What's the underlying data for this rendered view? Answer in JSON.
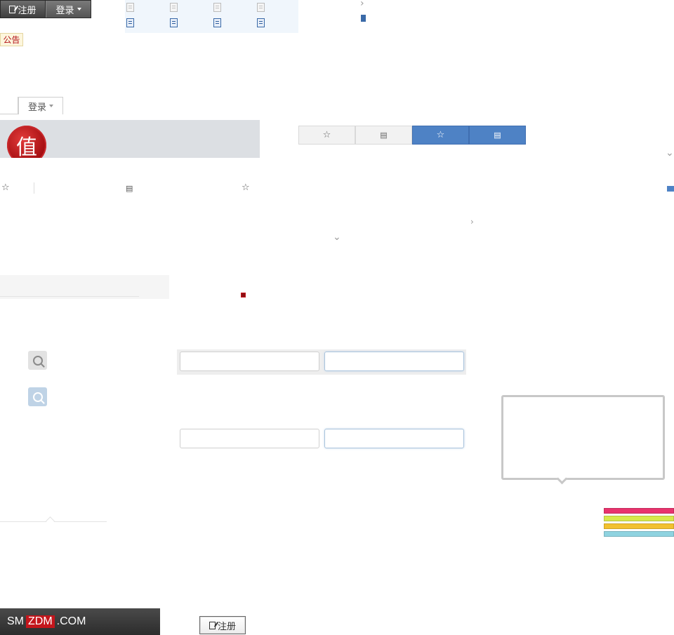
{
  "top_buttons": {
    "register_label": "注册",
    "login_label": "登录"
  },
  "notice": {
    "label": "公告"
  },
  "login_tab": {
    "label": "登录"
  },
  "banner": {
    "seal_char": "值"
  },
  "footer": {
    "brand_sm": "SM",
    "brand_zdm": "ZDM",
    "brand_com": ".COM"
  },
  "register_button": {
    "label": "注册"
  },
  "colors": {
    "accent_blue": "#4e82c5",
    "bar_pink": "#e8336d",
    "bar_lime": "#d7e84a",
    "bar_yellow": "#f2c12e",
    "bar_cyan": "#8fd3e0"
  }
}
